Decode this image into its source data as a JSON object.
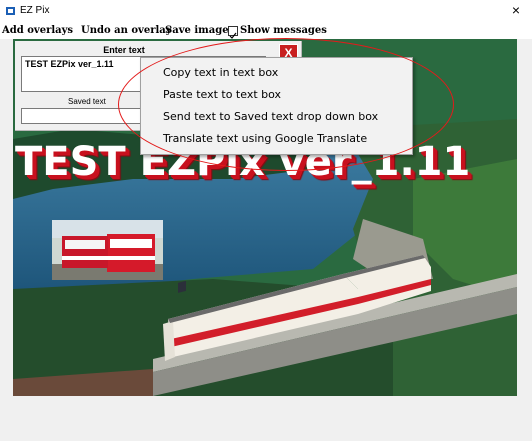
{
  "window": {
    "title": "EZ Pix",
    "close_glyph": "×"
  },
  "menubar": {
    "add_overlays": "Add overlays",
    "undo_overlay": "Undo an overlay",
    "save_image": "Save image",
    "show_messages": "Show messages",
    "show_messages_checked": true
  },
  "panel": {
    "enter_text_label": "Enter text",
    "text_value": "TEST EZPix ver_1.11",
    "close_label": "X",
    "saved_text_label": "Saved text",
    "saved_text_value": ""
  },
  "context_menu": {
    "items": [
      "Copy text in text box",
      "Paste text to text box",
      "Send text to Saved text drop down box",
      "Translate text using Google Translate"
    ]
  },
  "canvas": {
    "overlay_text": "TEST EZPix ver_1.11",
    "overlay_text_color": "#ffffff",
    "overlay_shadow_color": "#c8101e"
  },
  "colors": {
    "annotation": "#e31b1b",
    "close_button": "#c81f1f"
  },
  "icons": {
    "app": "ez-pix-app-icon",
    "close": "close-icon"
  }
}
